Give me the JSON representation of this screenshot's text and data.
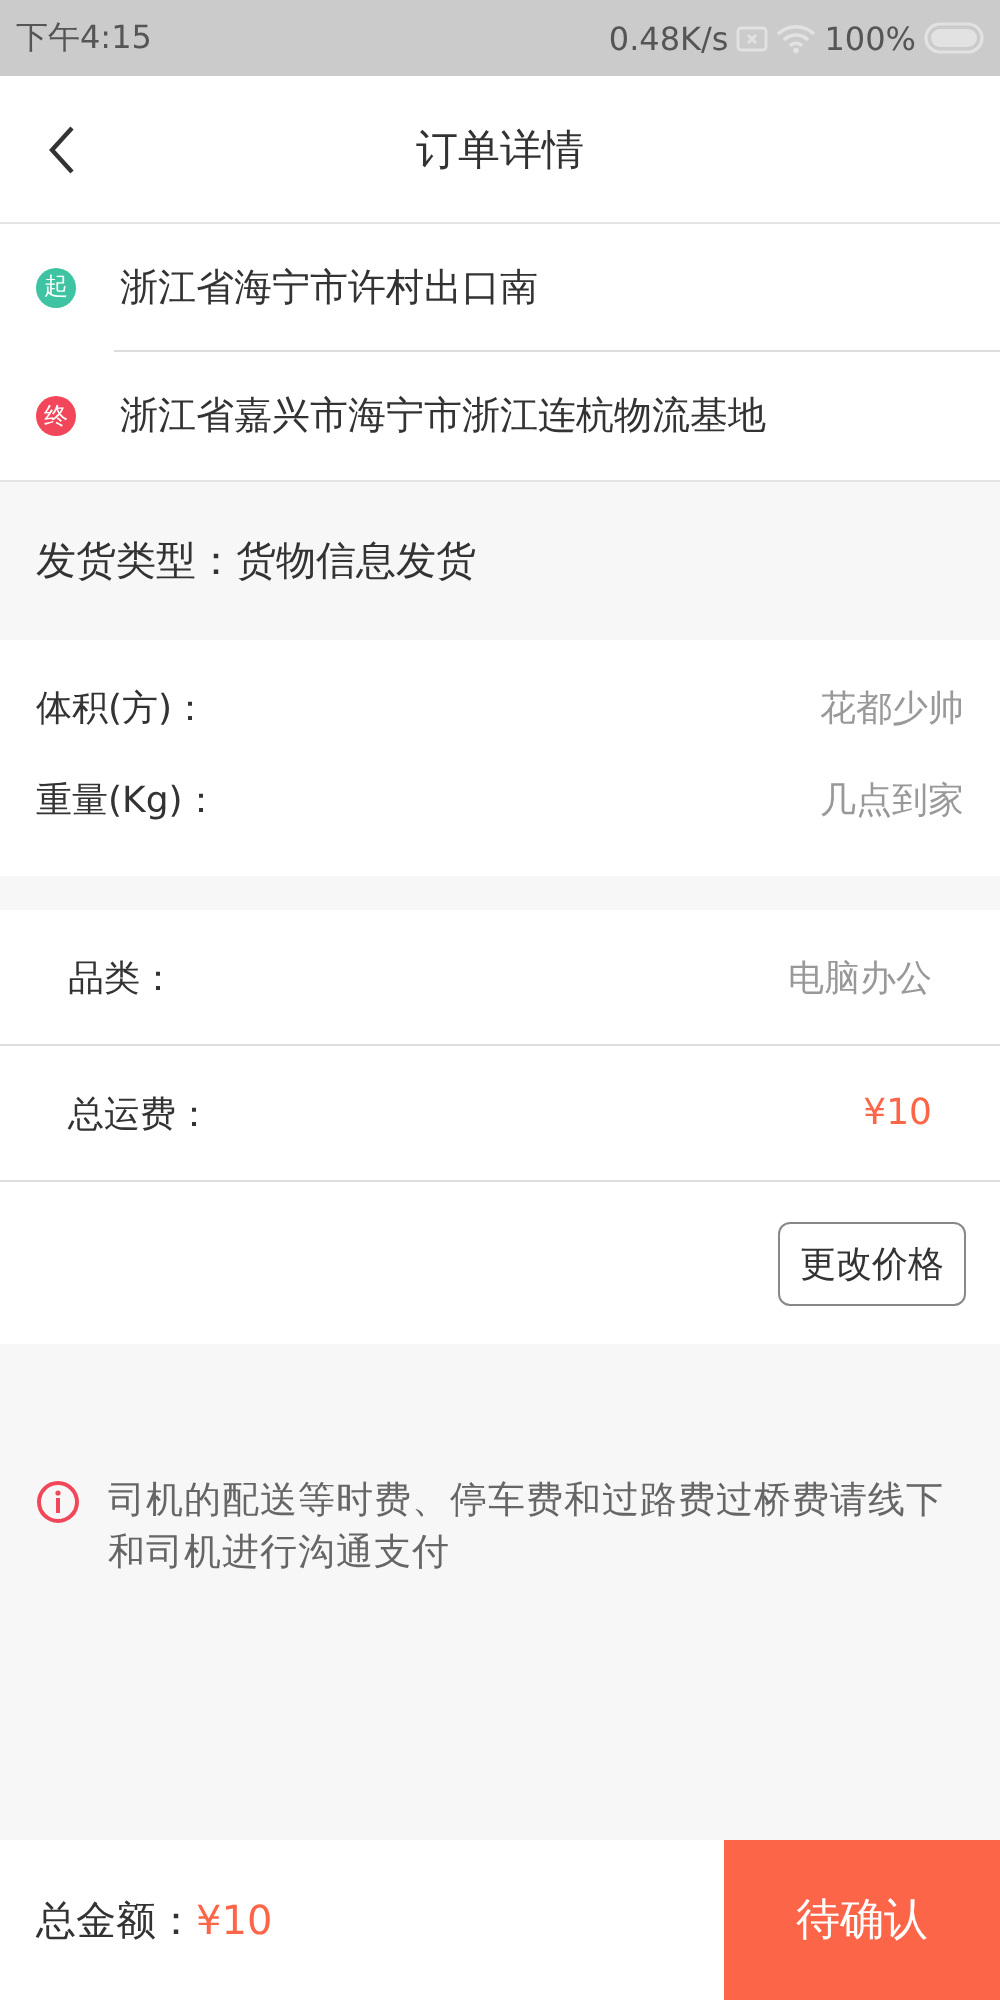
{
  "status_bar": {
    "time": "下午4:15",
    "speed": "0.48K/s",
    "battery": "100%"
  },
  "header": {
    "title": "订单详情"
  },
  "route": [
    {
      "kind": "start",
      "badge": "起",
      "address": "浙江省海宁市许村出口南"
    },
    {
      "kind": "end",
      "badge": "终",
      "address": "浙江省嘉兴市海宁市浙江连杭物流基地"
    }
  ],
  "shipping_type": "发货类型：货物信息发货",
  "cargo": [
    {
      "label": "体积(方)：",
      "value": "花都少帅"
    },
    {
      "label": "重量(Kg)：",
      "value": "几点到家"
    }
  ],
  "details": [
    {
      "kind": "plain",
      "label": "品类：",
      "value": "电脑办公"
    },
    {
      "kind": "price",
      "label": "总运费：",
      "value": "¥10"
    }
  ],
  "change_price_button": "更改价格",
  "notice": "司机的配送等时费、停车费和过路费过桥费请线下和司机进行沟通支付",
  "footer": {
    "total_label": "总金额：",
    "total": "¥10",
    "action": "待确认"
  }
}
